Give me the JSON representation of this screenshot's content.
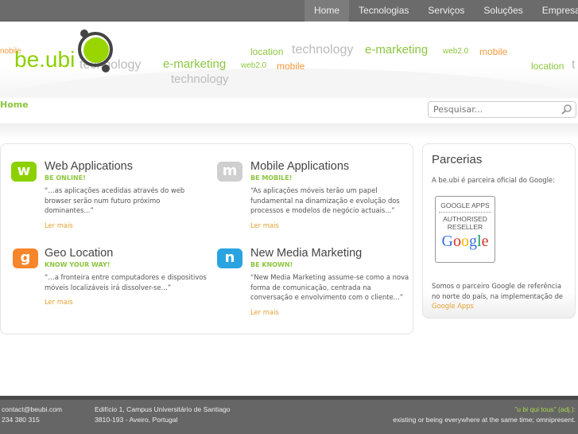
{
  "nav": {
    "items": [
      {
        "label": "Home",
        "active": true
      },
      {
        "label": "Tecnologias"
      },
      {
        "label": "Serviços"
      },
      {
        "label": "Soluções"
      },
      {
        "label": "Empresa"
      }
    ]
  },
  "logo": {
    "text": "be.ubi"
  },
  "tag_cloud": [
    "nobile",
    "location",
    "technology",
    "e-marketing",
    "web2.0",
    "mobile",
    "technology",
    "e-marketing",
    "web2.0",
    "mobile",
    "location",
    "t",
    "technology"
  ],
  "breadcrumb": "Home",
  "search": {
    "placeholder": "Pesquisar..."
  },
  "services": [
    {
      "icon": "w",
      "color": "#8cd000",
      "title": "Web Applications",
      "subtitle": "BE ONLINE!",
      "text": "“…as aplicações acedidas através do web browser serão num futuro próximo dominantes...”",
      "more": "Ler mais"
    },
    {
      "icon": "m",
      "color": "#cfcfcf",
      "title": "Mobile Applications",
      "subtitle": "BE MOBILE!",
      "text": "“As aplicações móveis terão um papel fundamental na dinamização e evolução dos processos e modelos de negócio actuais...”",
      "more": "Ler mais"
    },
    {
      "icon": "g",
      "color": "#f7852a",
      "title": "Geo Location",
      "subtitle": "KNOW YOUR WAY!",
      "text": "“…a fronteira entre computadores e dispositivos móveis localizáveis irá dissolver-se…”",
      "more": "Ler mais"
    },
    {
      "icon": "n",
      "color": "#2aa4e0",
      "title": "New Media Marketing",
      "subtitle": "BE KNOWN!",
      "text": "“New Media Marketing assume-se como a nova forma de comunicação, centrada na conversação e envolvimento com o cliente...”",
      "more": "Ler mais"
    }
  ],
  "sidebar": {
    "title": "Parcerias",
    "intro": "A be.ubi é parceira oficial do Google:",
    "badge": {
      "line1": "GOOGLE APPS",
      "line2": "AUTHORISED",
      "line3": "RESELLER",
      "brand": "Google"
    },
    "text": "Somos o parceiro Google de referência no norte do país, na implementação de",
    "link": "Google Apps"
  },
  "footer": {
    "email": "contact@beubi.com",
    "phone": "234 380 315",
    "address1": "Edifício 1, Campus Universitário de Santiago",
    "address2": "3810-193 - Aveiro, Portugal",
    "quote": "\"u bi qui tous\" (adj.):",
    "definition": "existing or being everywhere at the same time; omnipresent."
  }
}
